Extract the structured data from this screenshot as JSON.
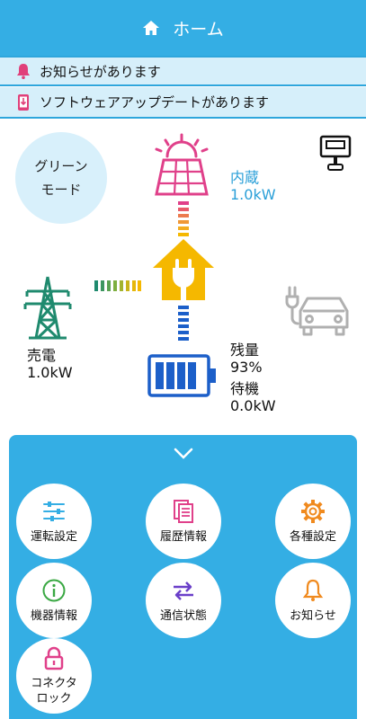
{
  "header": {
    "title": "ホーム"
  },
  "notices": [
    {
      "text": "お知らせがあります"
    },
    {
      "text": "ソフトウェアアップデートがあります"
    }
  ],
  "mode": {
    "line1": "グリーン",
    "line2": "モード"
  },
  "solar": {
    "label": "内蔵",
    "value": "1.0kW"
  },
  "grid": {
    "label": "売電",
    "value": "1.0kW"
  },
  "battery": {
    "remain_label": "残量",
    "remain_value": "93%",
    "status_label": "待機",
    "status_value": "0.0kW"
  },
  "menu": {
    "items": [
      {
        "label": "運転設定",
        "icon": "sliders-icon"
      },
      {
        "label": "履歴情報",
        "icon": "documents-icon"
      },
      {
        "label": "各種設定",
        "icon": "gear-icon"
      },
      {
        "label": "機器情報",
        "icon": "info-icon"
      },
      {
        "label": "通信状態",
        "icon": "arrows-icon"
      },
      {
        "label": "お知らせ",
        "icon": "bell-icon"
      },
      {
        "label_line1": "コネクタ",
        "label_line2": "ロック",
        "icon": "lock-icon"
      }
    ]
  },
  "colors": {
    "accent": "#34aee4",
    "solar": "#e0408a",
    "house": "#f5b800",
    "grid": "#1f8a6e",
    "battery": "#1c5fc9"
  }
}
